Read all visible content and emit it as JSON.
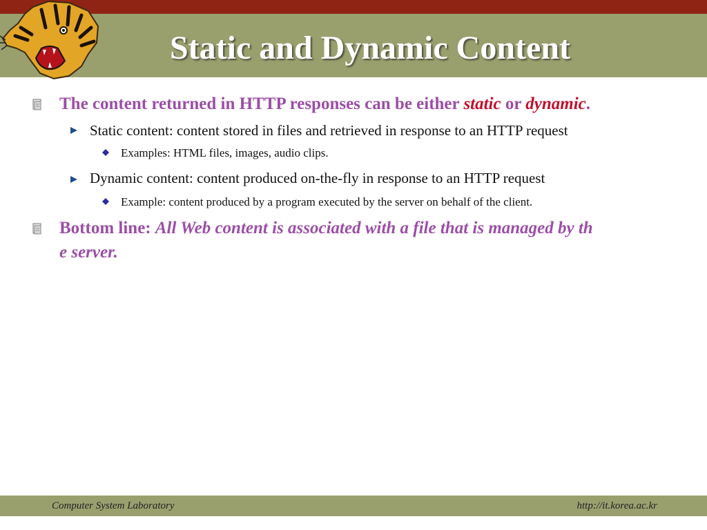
{
  "slide": {
    "title": "Static and Dynamic Content",
    "bullets": {
      "b1": {
        "pre": "The content returned in HTTP responses can be either ",
        "em1": "static",
        "mid": " or ",
        "em2": "dynamic",
        "post": "."
      },
      "b1_1": "Static content: content stored in files and retrieved in response to an HTTP request",
      "b1_1_1": "Examples: HTML files, images, audio clips.",
      "b1_2": "Dynamic content: content produced on-the-fly in response to an HTTP request",
      "b1_2_1": "Example: content produced by a program executed by the server on behalf of the client.",
      "b2": {
        "pre": "Bottom line: ",
        "line1": "All Web content is associated with a file that is managed by th",
        "line2": "e server."
      }
    }
  },
  "footer": {
    "left": "Computer System Laboratory",
    "right": "http://it.korea.ac.kr"
  },
  "colors": {
    "header_red": "#8f2415",
    "header_olive": "#99a06e",
    "accent_purple": "#9b4fa6",
    "accent_red": "#c0102b"
  },
  "icons": {
    "logo": "tiger-head-logo",
    "level1_bullet": "document-icon",
    "level2_bullet": "triangle-arrow-icon",
    "level3_bullet": "diamond-icon"
  }
}
